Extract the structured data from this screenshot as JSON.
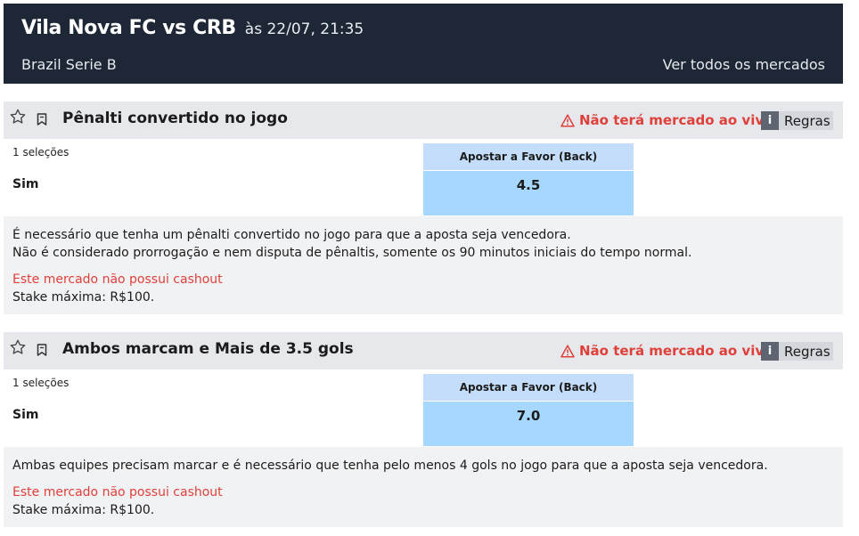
{
  "header": {
    "match_title": "Vila Nova FC vs CRB",
    "match_time": "às 22/07, 21:35",
    "league": "Brazil Serie B",
    "all_markets_link": "Ver todos os mercados"
  },
  "markets": [
    {
      "title": "Pênalti convertido no jogo",
      "no_live_notice": "Não terá mercado ao vivo",
      "rules_info": "i",
      "rules_label": "Regras",
      "selection_count": "1 seleções",
      "back_header": "Apostar a Favor (Back)",
      "runner": "Sim",
      "odds": "4.5",
      "description_lines": [
        "É necessário que tenha um pênalti convertido no jogo para que a aposta seja vencedora.",
        "Não é considerado prorrogação e nem disputa de pênaltis, somente os 90 minutos iniciais do tempo normal."
      ],
      "cashout_notice": "Este mercado não possui cashout",
      "max_stake": "Stake máxima: R$100."
    },
    {
      "title": "Ambos marcam e Mais de 3.5 gols",
      "no_live_notice": "Não terá mercado ao vivo",
      "rules_info": "i",
      "rules_label": "Regras",
      "selection_count": "1 seleções",
      "back_header": "Apostar a Favor (Back)",
      "runner": "Sim",
      "odds": "7.0",
      "description_lines": [
        "Ambas equipes precisam marcar e é necessário que tenha pelo menos 4 gols no jogo para que a aposta seja vencedora."
      ],
      "cashout_notice": "Este mercado não possui cashout",
      "max_stake": "Stake máxima: R$100."
    }
  ],
  "icons": {
    "favorite": "star-outline-icon",
    "pin": "bookmark-icon",
    "warning": "warning-triangle-icon",
    "info": "info-icon"
  },
  "colors": {
    "header_bg": "#1e2735",
    "market_bar_bg": "#e6e8ec",
    "back_header_bg": "#c3ddfa",
    "back_odds_bg": "#a6d8ff",
    "warning_red": "#e0403a",
    "description_bg": "#f1f2f4"
  }
}
